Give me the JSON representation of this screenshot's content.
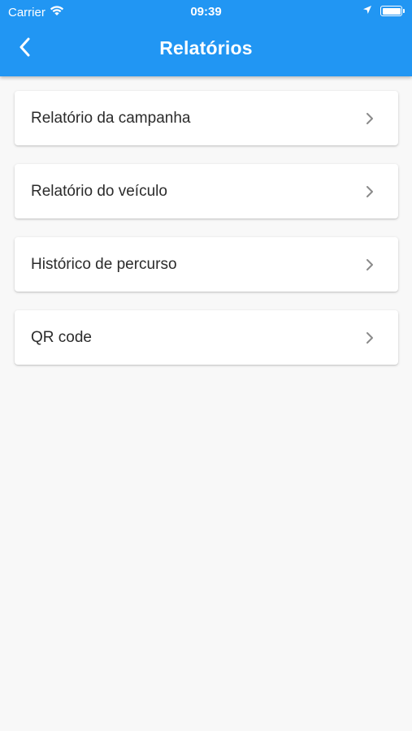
{
  "status_bar": {
    "carrier": "Carrier",
    "time": "09:39"
  },
  "header": {
    "title": "Relatórios",
    "back_icon": "chevron-left-icon"
  },
  "menu": {
    "items": [
      {
        "label": "Relatório da campanha",
        "icon": "chevron-right-icon"
      },
      {
        "label": "Relatório do veículo",
        "icon": "chevron-right-icon"
      },
      {
        "label": "Histórico de percurso",
        "icon": "chevron-right-icon"
      },
      {
        "label": "QR code",
        "icon": "chevron-right-icon"
      }
    ]
  },
  "colors": {
    "app_bar": "#2196f3",
    "background": "#f8f8f8",
    "card": "#ffffff",
    "text": "#2b2b2b",
    "chevron": "#8a8a8a"
  }
}
